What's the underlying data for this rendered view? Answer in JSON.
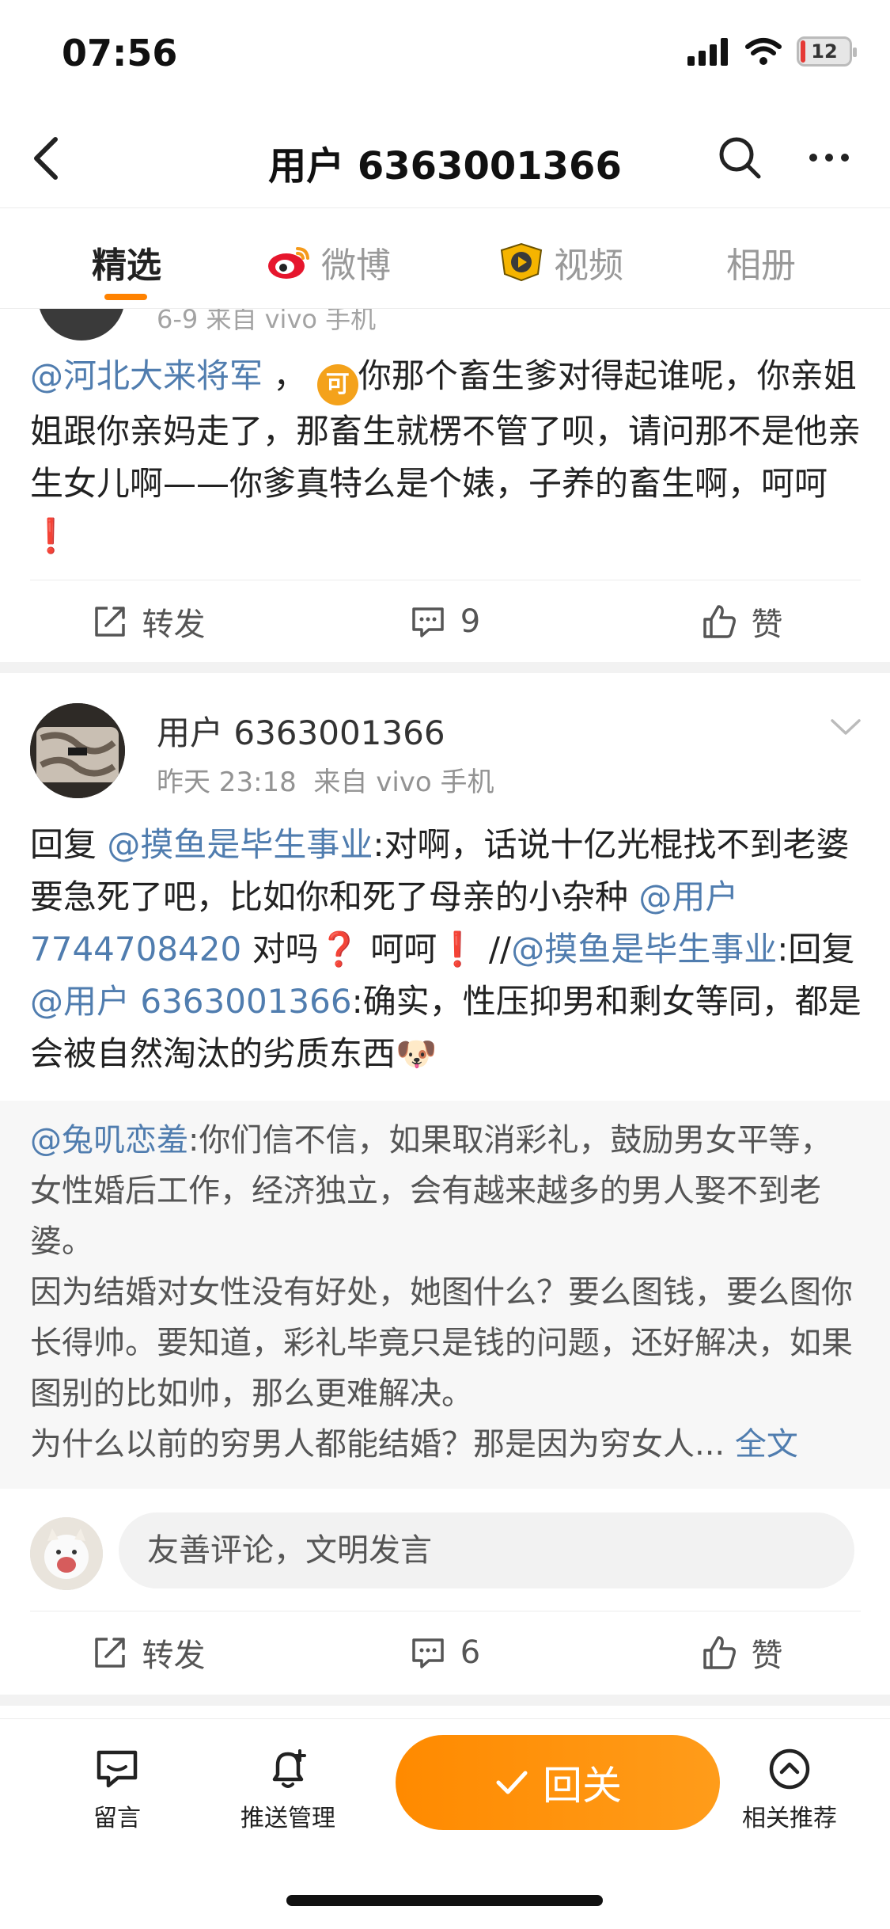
{
  "status_bar": {
    "time": "07:56",
    "battery": "12"
  },
  "nav": {
    "title": "用户 6363001366"
  },
  "tabs": [
    {
      "label": "精选"
    },
    {
      "label": "微博"
    },
    {
      "label": "视频"
    },
    {
      "label": "相册"
    }
  ],
  "post1": {
    "meta": "6-9  来自 vivo 手机",
    "mention": "@河北大来将军",
    "sep": " ，",
    "emoji": "可",
    "text": "你那个畜生爹对得起谁呢，你亲姐姐跟你亲妈走了，那畜生就楞不管了呗，请问那不是他亲生女儿啊——你爹真特么是个婊，子养的畜生啊，呵呵",
    "bang": "❗",
    "repost_label": "转发",
    "comment_count": "9",
    "like_label": "赞"
  },
  "post2": {
    "user_name": "用户 6363001366",
    "time": "昨天 23:18",
    "source": "来自 vivo 手机",
    "parts": {
      "p1": "回复 ",
      "m1": "@摸鱼是毕生事业",
      "p2": ":对啊，话说十亿光棍找不到老婆要急死了吧，比如你和死了母亲的小杂种 ",
      "m2": "@用户 7744708420",
      "p3": " 对吗",
      "bang1": "❓",
      "p4": " 呵呵",
      "bang2": "❗",
      "p5": " //",
      "m3": "@摸鱼是毕生事业",
      "p6": ":回复 ",
      "m4": "@用户 6363001366",
      "p7": ":确实，性压抑男和剩女等同，都是会被自然淘汰的劣质东西",
      "emoji2": "🐶"
    },
    "quote": {
      "mention": "@兔叽恋羞",
      "line1": ":你们信不信，如果取消彩礼，鼓励男女平等，女性婚后工作，经济独立，会有越来越多的男人娶不到老婆。",
      "line2": "因为结婚对女性没有好处，她图什么？要么图钱，要么图你长得帅。要知道，彩礼毕竟只是钱的问题，还好解决，如果图别的比如帅，那么更难解决。",
      "line3": "为什么以前的穷男人都能结婚？那是因为穷女人...",
      "full_link": "全文"
    },
    "comment_placeholder": "友善评论，文明发言",
    "repost_label": "转发",
    "comment_count": "6",
    "like_label": "赞"
  },
  "bottom_bar": {
    "message_label": "留言",
    "push_label": "推送管理",
    "reply_label": "回关",
    "related_label": "相关推荐"
  },
  "colors": {
    "accent": "#ff8200",
    "link": "#507daf"
  }
}
